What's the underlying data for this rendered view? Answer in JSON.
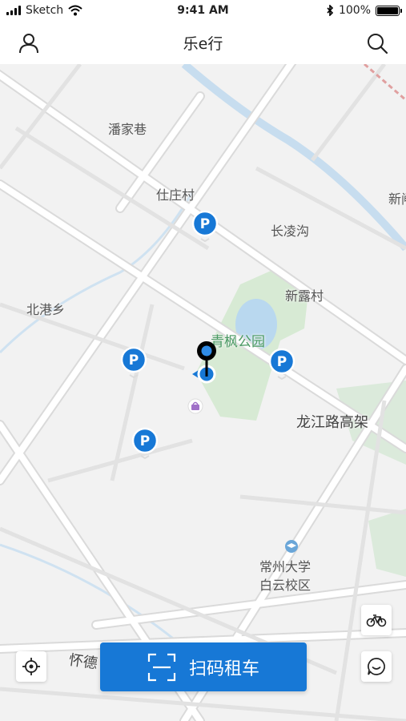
{
  "status_bar": {
    "carrier": "Sketch",
    "time": "9:41 AM",
    "battery_percent": "100%",
    "battery_level": 1.0
  },
  "nav": {
    "title": "乐e行",
    "left_icon": "user-icon",
    "right_icon": "search-icon"
  },
  "map": {
    "places": {
      "panjia": "潘家巷",
      "shizhuang": "仕庄村",
      "changling": "长凌沟",
      "xinlu": "新露村",
      "xin_edge": "新闸",
      "beigang": "北港乡",
      "park": "青枫公园",
      "longjiang": "龙江路高架",
      "changzhou1": "常州大学",
      "changzhou2": "白云校区",
      "huaide": "怀德"
    },
    "parking_label": "P"
  },
  "controls": {
    "locate_icon": "crosshair-icon",
    "bike_icon": "bicycle-icon",
    "chat_icon": "chat-icon"
  },
  "scan_button": {
    "label": "扫码租车",
    "icon": "scan-icon"
  },
  "colors": {
    "accent": "#1778d6",
    "parking_blue": "#1778d6",
    "park_green": "#d7ead4"
  }
}
